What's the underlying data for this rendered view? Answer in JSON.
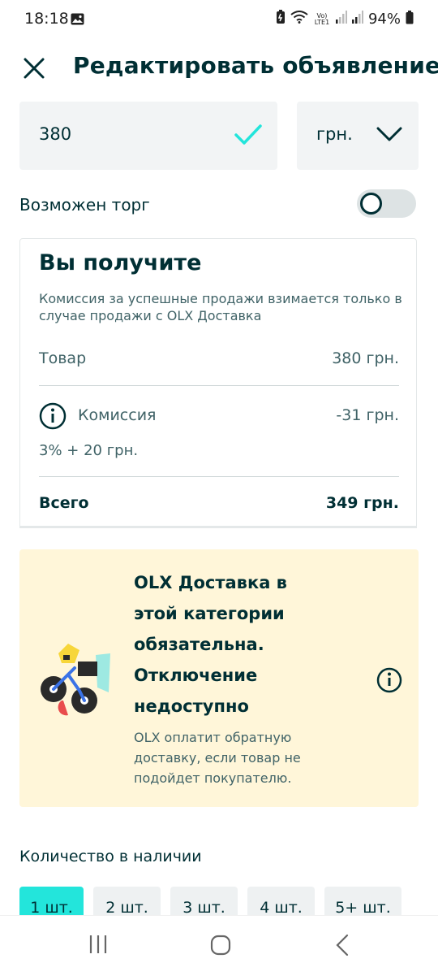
{
  "status": {
    "time": "18:18",
    "lte": "Vo) LTE1",
    "battery": "94%"
  },
  "header": {
    "title": "Редактировать объявление"
  },
  "price": {
    "value": "380",
    "currency": "грн."
  },
  "negotiable": {
    "label": "Возможен торг",
    "enabled": false
  },
  "receive": {
    "title": "Вы получите",
    "note": "Комиссия за успешные продажи взимается только в случае продажи с OLX Доставка",
    "item_label": "Товар",
    "item_value": "380 грн.",
    "commission_label": "Комиссия",
    "commission_value": "-31 грн.",
    "commission_formula": "3% + 20 грн.",
    "total_label": "Всего",
    "total_value": "349 грн."
  },
  "promo": {
    "title": "OLX Доставка в этой категории обязательна. Отключение недоступно",
    "text": "OLX оплатит обратную доставку, если товар не подойдет покупателю."
  },
  "quantity": {
    "label": "Количество в наличии",
    "options": [
      "1 шт.",
      "2 шт.",
      "3 шт.",
      "4 шт.",
      "5+ шт."
    ],
    "selected": 0
  },
  "colors": {
    "accent": "#23e5db",
    "text": "#002f34",
    "muted": "#406367",
    "promo_bg": "#fff6d9"
  }
}
